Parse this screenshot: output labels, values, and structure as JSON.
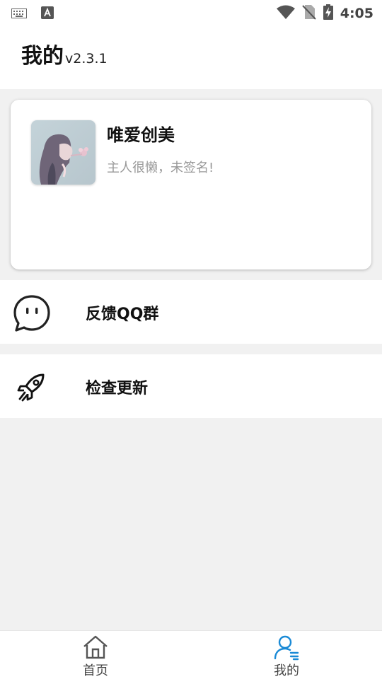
{
  "status_bar": {
    "time": "4:05",
    "icons": [
      "keyboard-icon",
      "a-notification-icon",
      "wifi-icon",
      "no-sim-icon",
      "battery-charging-icon"
    ]
  },
  "header": {
    "title": "我的",
    "version": "v2.3.1"
  },
  "profile": {
    "username": "唯爱创美",
    "signature": "主人很懒，未签名!"
  },
  "menu": [
    {
      "label": "反馈QQ群",
      "icon": "chat-bubble-icon"
    },
    {
      "label": "检查更新",
      "icon": "rocket-icon"
    }
  ],
  "bottom_nav": {
    "tabs": [
      {
        "label": "首页",
        "icon": "home-icon",
        "active": false
      },
      {
        "label": "我的",
        "icon": "user-profile-icon",
        "active": true
      }
    ],
    "active_color": "#1a8ad6",
    "inactive_color": "#555555"
  }
}
